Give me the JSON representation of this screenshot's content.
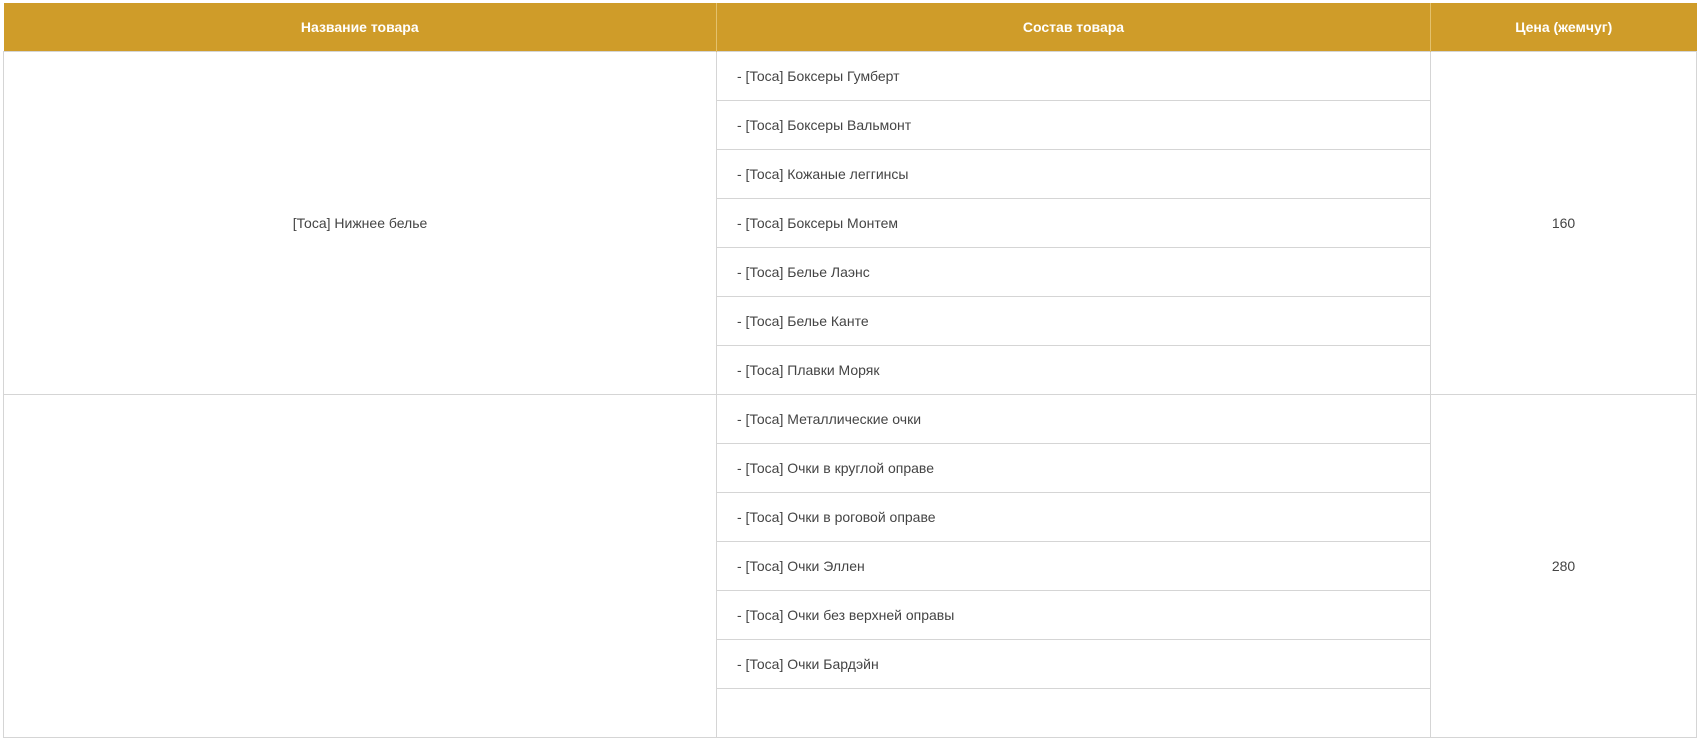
{
  "table": {
    "headers": {
      "name": "Название товара",
      "contents": "Состав товара",
      "price": "Цена (жемчуг)"
    },
    "rows": [
      {
        "name": "[Тоса] Нижнее белье",
        "price": "160",
        "items": [
          "- [Тоса] Боксеры Гумберт",
          "- [Тоса] Боксеры Вальмонт",
          "- [Тоса] Кожаные леггинсы",
          "- [Тоса] Боксеры Монтем",
          "- [Тоса] Белье Лаэнс",
          "- [Тоса] Белье Канте",
          "- [Тоса] Плавки Моряк"
        ]
      },
      {
        "name": "",
        "price": "280",
        "items": [
          "- [Тоса] Металлические очки",
          "- [Тоса] Очки в круглой оправе",
          "- [Тоса] Очки в роговой оправе",
          "- [Тоса] Очки Эллен",
          "- [Тоса] Очки без верхней оправы",
          "- [Тоса] Очки Бардэйн",
          ""
        ]
      }
    ]
  },
  "colors": {
    "header_bg": "#cf9c29",
    "header_text": "#ffffff",
    "border": "#d5d5d5",
    "body_text": "#444444"
  }
}
